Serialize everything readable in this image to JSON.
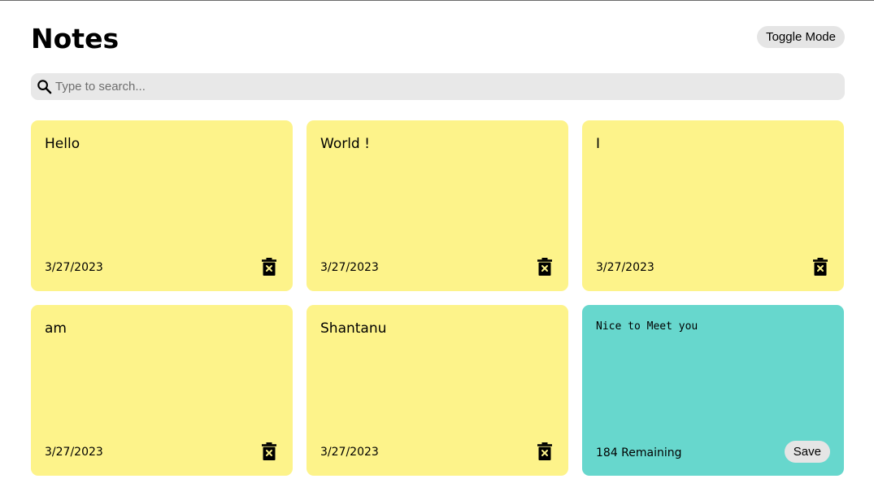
{
  "header": {
    "title": "Notes",
    "toggle_label": "Toggle Mode"
  },
  "search": {
    "placeholder": "Type to search...",
    "icon": "search-icon"
  },
  "notes": [
    {
      "text": "Hello",
      "date": "3/27/2023"
    },
    {
      "text": "World !",
      "date": "3/27/2023"
    },
    {
      "text": "I",
      "date": "3/27/2023"
    },
    {
      "text": "am",
      "date": "3/27/2023"
    },
    {
      "text": "Shantanu",
      "date": "3/27/2023"
    }
  ],
  "new_note": {
    "text": "Nice to Meet you",
    "remaining": "184 Remaining",
    "save_label": "Save"
  },
  "colors": {
    "note_bg": "#fdf38a",
    "new_note_bg": "#67d7cd",
    "search_bg": "#e8e8e8",
    "button_bg": "#e5e5e5"
  }
}
